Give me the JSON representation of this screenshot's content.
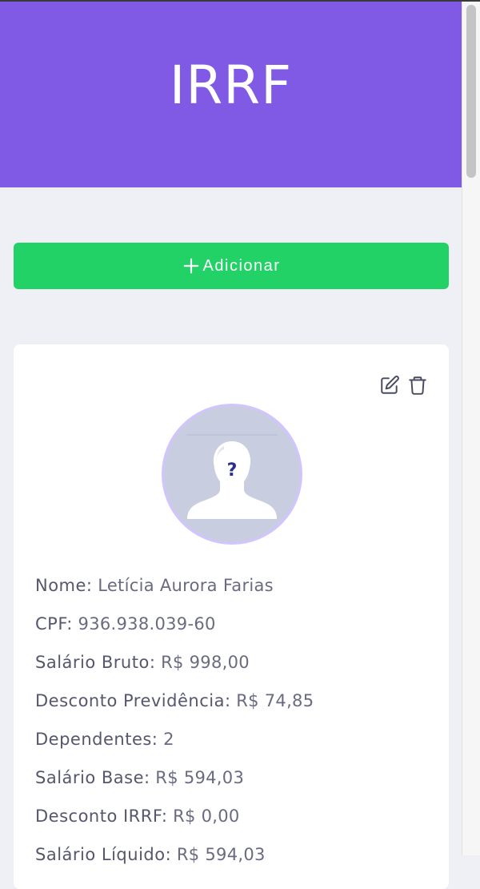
{
  "header": {
    "title": "IRRF"
  },
  "actions": {
    "add_label": "Adicionar"
  },
  "colors": {
    "header_bg": "#805ae4",
    "add_button": "#22d266",
    "page_bg": "#eff0f5",
    "avatar_border": "#d2c4ff"
  },
  "icons": {
    "add": "plus-icon",
    "edit": "edit-icon",
    "delete": "trash-icon",
    "avatar": "unknown-user-icon"
  },
  "record": {
    "fields": [
      {
        "label": "Nome:",
        "value": "Letícia Aurora Farias"
      },
      {
        "label": "CPF:",
        "value": "936.938.039-60"
      },
      {
        "label": "Salário Bruto:",
        "value": "R$ 998,00"
      },
      {
        "label": "Desconto Previdência:",
        "value": "R$ 74,85"
      },
      {
        "label": "Dependentes:",
        "value": "2"
      },
      {
        "label": "Salário Base:",
        "value": "R$ 594,03"
      },
      {
        "label": "Desconto IRRF:",
        "value": "R$ 0,00"
      },
      {
        "label": "Salário Líquido:",
        "value": "R$ 594,03"
      }
    ]
  }
}
